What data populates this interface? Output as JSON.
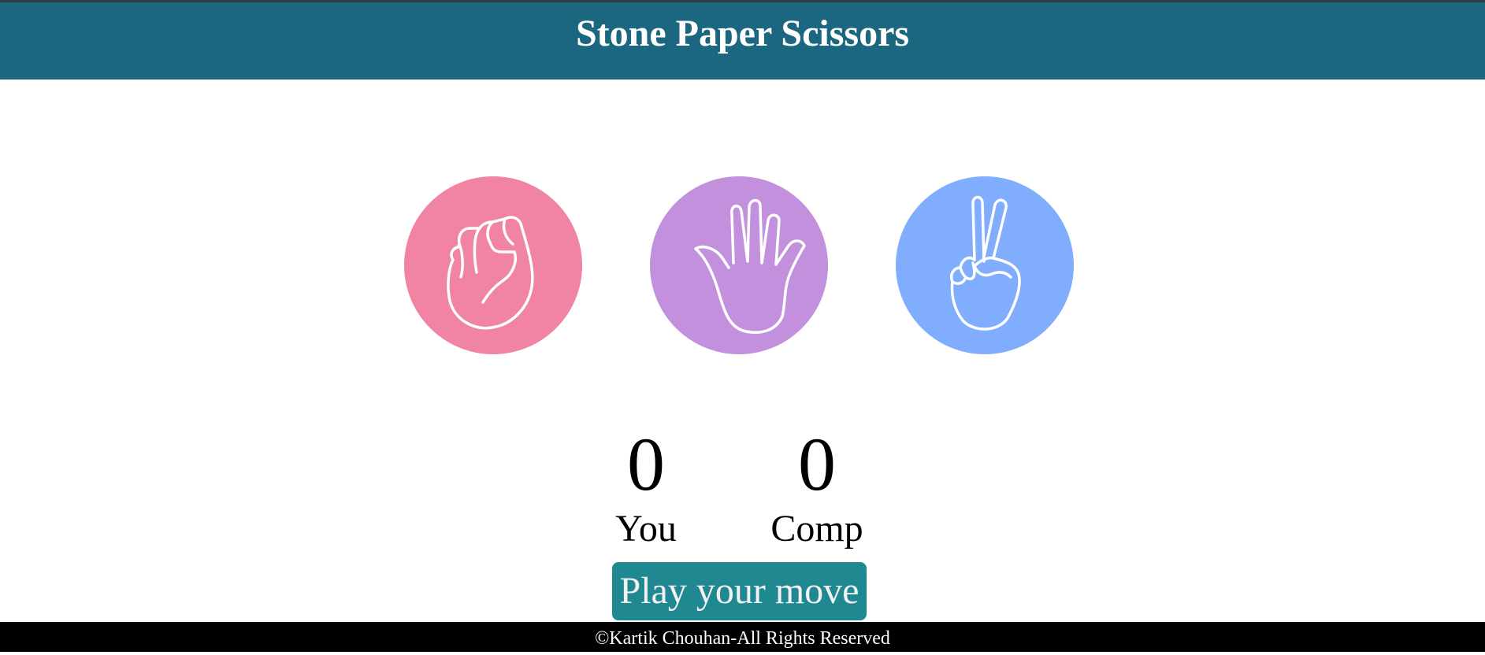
{
  "header": {
    "title": "Stone Paper Scissors"
  },
  "choices": [
    {
      "name": "stone",
      "icon": "fist-icon",
      "color": "#f084a2"
    },
    {
      "name": "paper",
      "icon": "open-hand-icon",
      "color": "#c290dd"
    },
    {
      "name": "scissors",
      "icon": "peace-hand-icon",
      "color": "#80adfe"
    }
  ],
  "score": {
    "you": {
      "value": "0",
      "label": "You"
    },
    "comp": {
      "value": "0",
      "label": "Comp"
    }
  },
  "message": {
    "text": "Play your move",
    "color": "#1f8891"
  },
  "footer": {
    "text": "©Kartik Chouhan-All Rights Reserved"
  },
  "colors": {
    "header_bg": "#1b6780",
    "footer_bg": "#000000"
  }
}
